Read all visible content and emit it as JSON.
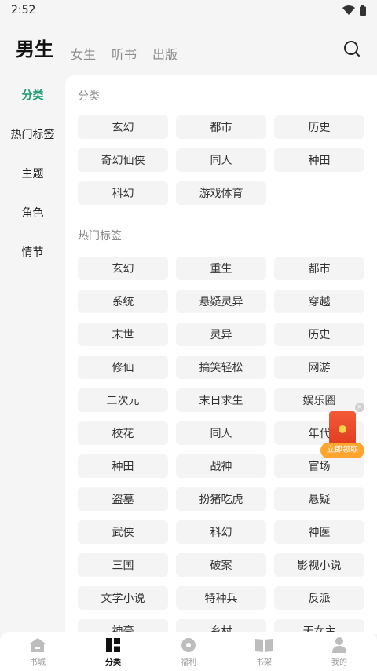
{
  "status_bar": {
    "time": "2:52"
  },
  "top_tabs": [
    {
      "label": "男生"
    },
    {
      "label": "女生"
    },
    {
      "label": "听书"
    },
    {
      "label": "出版"
    }
  ],
  "left_nav": [
    {
      "label": "分类"
    },
    {
      "label": "热门标签"
    },
    {
      "label": "主题"
    },
    {
      "label": "角色"
    },
    {
      "label": "情节"
    }
  ],
  "sections": [
    {
      "title": "分类",
      "tags": [
        "玄幻",
        "都市",
        "历史",
        "奇幻仙侠",
        "同人",
        "种田",
        "科幻",
        "游戏体育"
      ]
    },
    {
      "title": "热门标签",
      "tags": [
        "玄幻",
        "重生",
        "都市",
        "系统",
        "悬疑灵异",
        "穿越",
        "末世",
        "灵异",
        "历史",
        "修仙",
        "搞笑轻松",
        "网游",
        "二次元",
        "末日求生",
        "娱乐圈",
        "校花",
        "同人",
        "年代",
        "种田",
        "战神",
        "官场",
        "盗墓",
        "扮猪吃虎",
        "悬疑",
        "武侠",
        "科幻",
        "神医",
        "三国",
        "破案",
        "影视小说",
        "文学小说",
        "特种兵",
        "反派",
        "神豪",
        "乡村",
        "天女主"
      ]
    }
  ],
  "float_ad": {
    "label": "立即领取",
    "close": "×"
  },
  "bottom_nav": [
    {
      "label": "书城",
      "icon": "home-icon"
    },
    {
      "label": "分类",
      "icon": "category-icon"
    },
    {
      "label": "福利",
      "icon": "welfare-icon"
    },
    {
      "label": "书架",
      "icon": "bookshelf-icon"
    },
    {
      "label": "我的",
      "icon": "profile-icon"
    }
  ],
  "colors": {
    "accent": "#1a9b6d",
    "tag_bg": "#f4f4f4",
    "ad_orange": "#ffa42c"
  }
}
